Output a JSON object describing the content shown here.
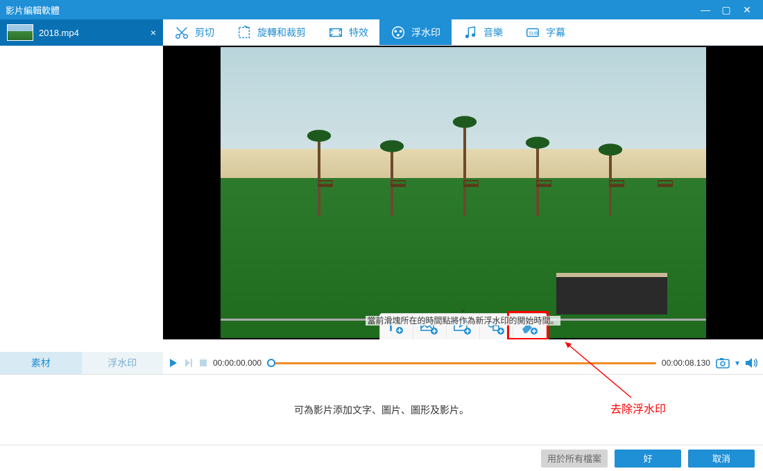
{
  "window": {
    "title": "影片編輯軟體",
    "min_icon": "—",
    "max_icon": "▢",
    "close_icon": "✕"
  },
  "file_tab": {
    "name": "2018.mp4",
    "close_icon": "×"
  },
  "main_tabs": [
    {
      "id": "cut",
      "label": "剪切",
      "icon": "scissors",
      "active": false
    },
    {
      "id": "rotate",
      "label": "旋轉和裁剪",
      "icon": "crop",
      "active": false
    },
    {
      "id": "effects",
      "label": "特效",
      "icon": "film",
      "active": false
    },
    {
      "id": "watermark",
      "label": "浮水印",
      "icon": "watermark",
      "active": true
    },
    {
      "id": "music",
      "label": "音樂",
      "icon": "music",
      "active": false
    },
    {
      "id": "subtitle",
      "label": "字幕",
      "icon": "subtitle",
      "active": false
    }
  ],
  "sidebar_tabs": [
    {
      "id": "material",
      "label": "素材",
      "active": true
    },
    {
      "id": "watermark",
      "label": "浮水印",
      "active": false
    }
  ],
  "watermark_tools": [
    {
      "id": "add-text",
      "icon": "T+"
    },
    {
      "id": "add-image",
      "icon": "img+"
    },
    {
      "id": "add-video",
      "icon": "vid+"
    },
    {
      "id": "add-shape",
      "icon": "shape+"
    },
    {
      "id": "remove-wm",
      "icon": "eraser+"
    }
  ],
  "timeline": {
    "start": "00:00:00.000",
    "end": "00:00:08.130",
    "hint": "當前滑塊所在的時間點將作為新浮水印的開始時間。"
  },
  "bottom": {
    "description": "可為影片添加文字、圖片、圖形及影片。",
    "annotation": "去除浮水印"
  },
  "buttons": {
    "apply_all": "用於所有檔案",
    "ok": "好",
    "cancel": "取消"
  }
}
